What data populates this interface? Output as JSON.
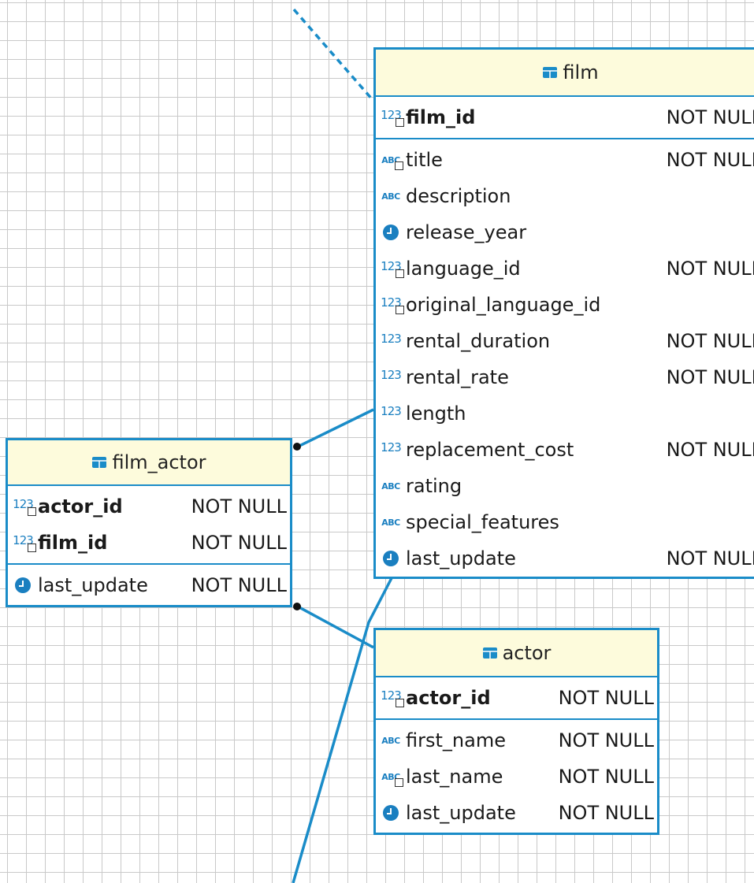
{
  "colors": {
    "border": "#1a8cc8",
    "header_bg": "#fdfbdc",
    "grid": "#c9c9c9",
    "icon": "#1a7fc0"
  },
  "tables": {
    "film": {
      "name": "film",
      "sections": [
        [
          {
            "icon": "numeric-key-icon",
            "name": "film_id",
            "constraint": "NOT NULL",
            "pk": true
          }
        ],
        [
          {
            "icon": "text-index-icon",
            "name": "title",
            "constraint": "NOT NULL"
          },
          {
            "icon": "text-icon",
            "name": "description",
            "constraint": ""
          },
          {
            "icon": "clock-icon",
            "name": "release_year",
            "constraint": ""
          },
          {
            "icon": "numeric-index-icon",
            "name": "language_id",
            "constraint": "NOT NULL"
          },
          {
            "icon": "numeric-index-icon",
            "name": "original_language_id",
            "constraint": ""
          },
          {
            "icon": "numeric-icon",
            "name": "rental_duration",
            "constraint": "NOT NULL"
          },
          {
            "icon": "numeric-icon",
            "name": "rental_rate",
            "constraint": "NOT NULL"
          },
          {
            "icon": "numeric-icon",
            "name": "length",
            "constraint": ""
          },
          {
            "icon": "numeric-icon",
            "name": "replacement_cost",
            "constraint": "NOT NULL"
          },
          {
            "icon": "text-icon",
            "name": "rating",
            "constraint": ""
          },
          {
            "icon": "text-icon",
            "name": "special_features",
            "constraint": ""
          },
          {
            "icon": "clock-icon",
            "name": "last_update",
            "constraint": "NOT NULL"
          }
        ]
      ]
    },
    "film_actor": {
      "name": "film_actor",
      "sections": [
        [
          {
            "icon": "numeric-key-icon",
            "name": "actor_id",
            "constraint": "NOT NULL",
            "pk": true
          },
          {
            "icon": "numeric-key-icon",
            "name": "film_id",
            "constraint": "NOT NULL",
            "pk": true
          }
        ],
        [
          {
            "icon": "clock-icon",
            "name": "last_update",
            "constraint": "NOT NULL"
          }
        ]
      ]
    },
    "actor": {
      "name": "actor",
      "sections": [
        [
          {
            "icon": "numeric-key-icon",
            "name": "actor_id",
            "constraint": "NOT NULL",
            "pk": true
          }
        ],
        [
          {
            "icon": "text-icon",
            "name": "first_name",
            "constraint": "NOT NULL"
          },
          {
            "icon": "text-index-icon",
            "name": "last_name",
            "constraint": "NOT NULL"
          },
          {
            "icon": "clock-icon",
            "name": "last_update",
            "constraint": "NOT NULL"
          }
        ]
      ]
    }
  }
}
